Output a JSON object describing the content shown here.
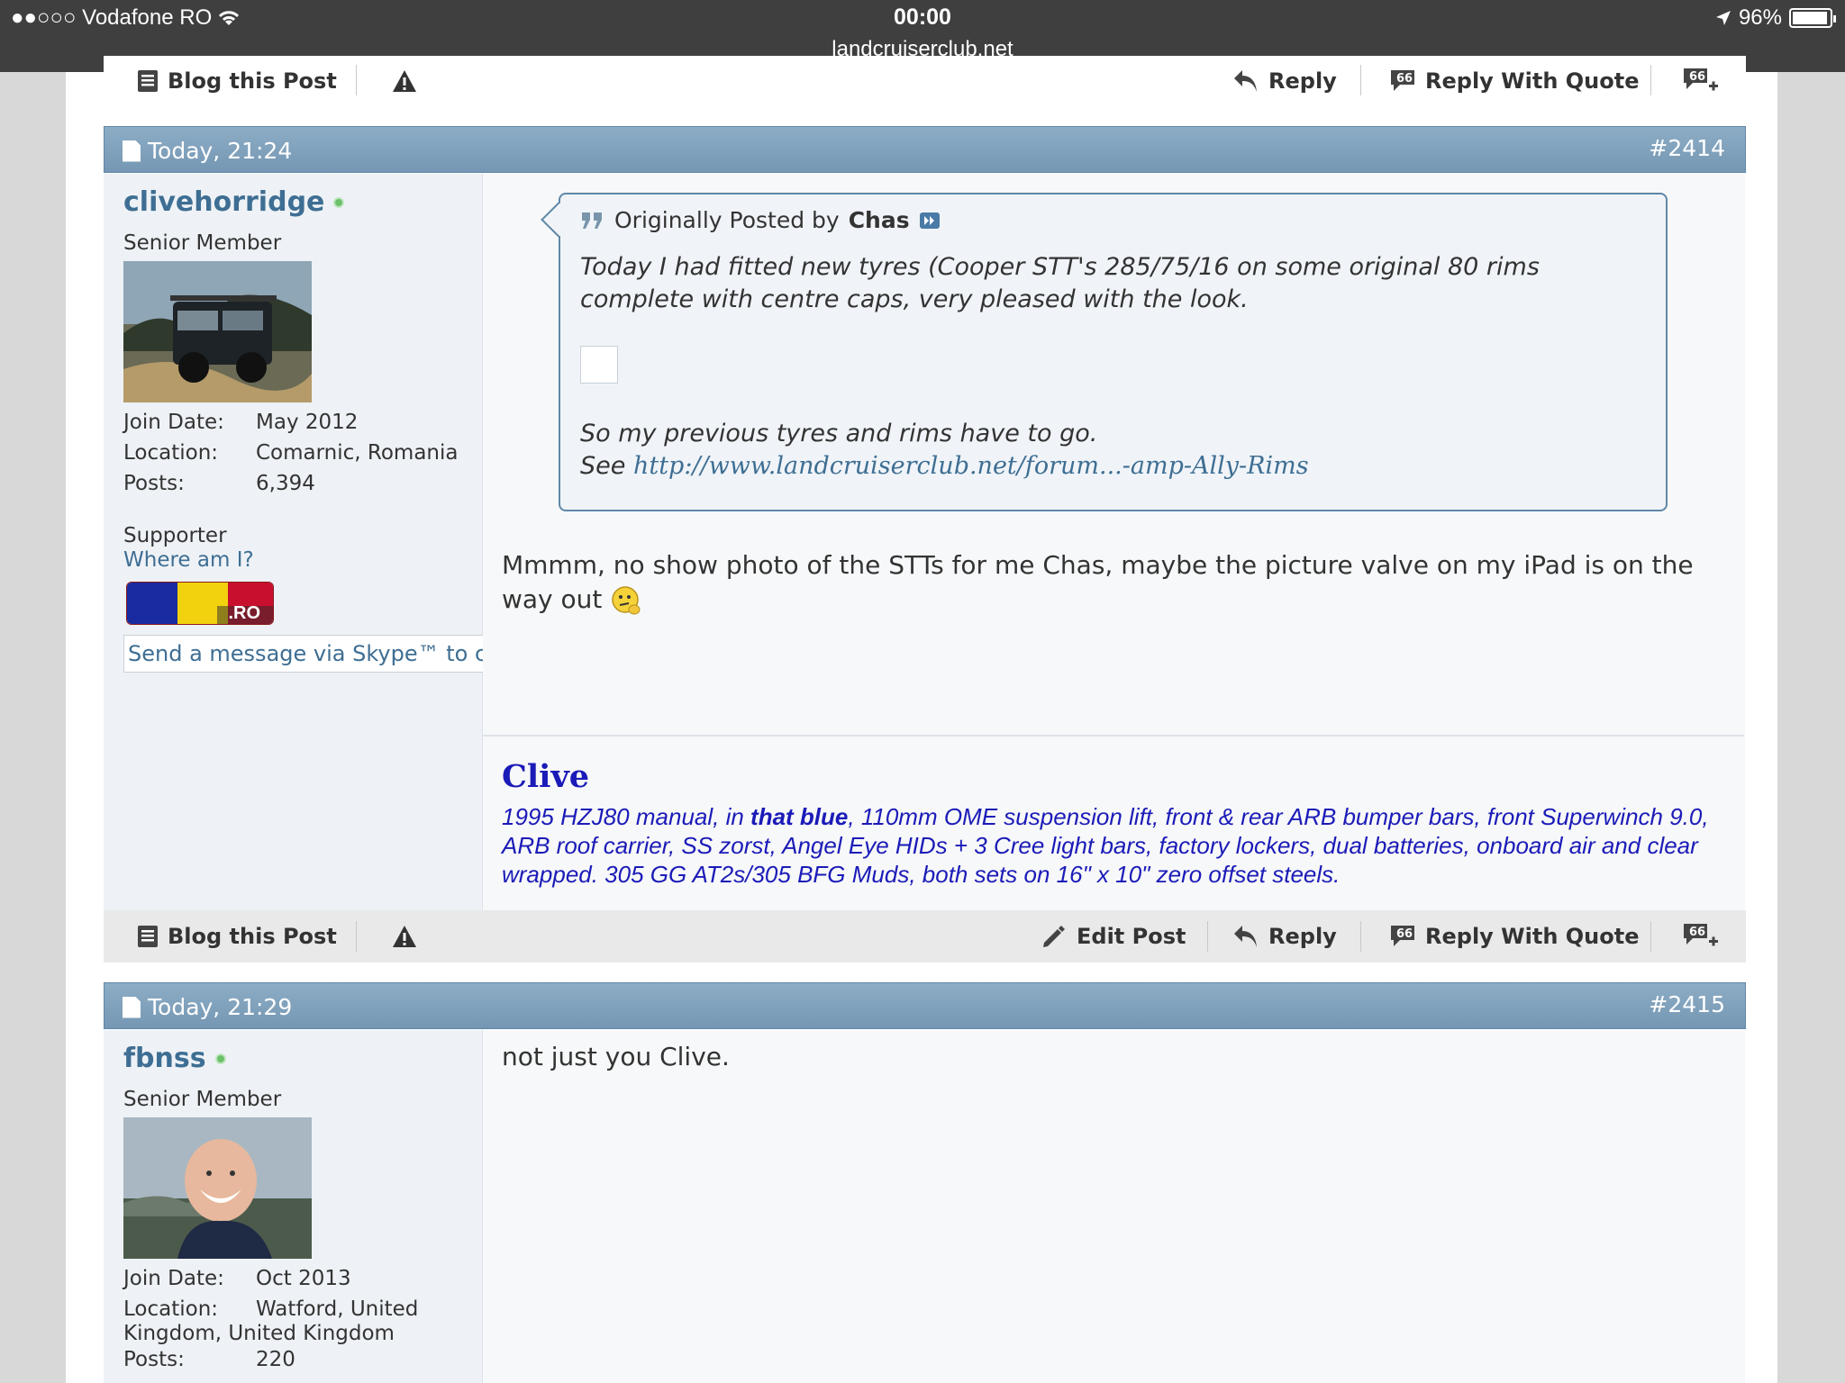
{
  "statusbar": {
    "carrier": "●●○○○ Vodafone RO",
    "time": "00:00",
    "url": "landcruiserclub.net",
    "battery": "96%"
  },
  "toolbar_top": {
    "blog": "Blog this Post",
    "reply": "Reply",
    "reply_quote": "Reply With Quote"
  },
  "post1": {
    "date": "Today, 21:24",
    "number": "#2414",
    "username": "clivehorridge",
    "user_title": "Senior Member",
    "join_label": "Join Date:",
    "join_value": "May 2012",
    "location_label": "Location:",
    "location_value": "Comarnic, Romania",
    "posts_label": "Posts:",
    "posts_value": "6,394",
    "supporter": "Supporter",
    "where_am_i": "Where am I?",
    "flag_code": ".RO",
    "skype": "Send a message via Skype™ to clivehorridge",
    "quote": {
      "prefix": "Originally Posted by",
      "author": "Chas",
      "line1": "Today I had fitted new tyres (Cooper STT's 285/75/16 on some original 80 rims",
      "line2": "complete with centre caps, very pleased with the look.",
      "line3": "So my previous tyres and rims have to go.",
      "see": "See",
      "link": "http://www.landcruiserclub.net/forum...-amp-Ally-Rims"
    },
    "message": "Mmmm, no show photo of the STTs for me Chas, maybe the picture valve on my iPad is on the way out",
    "signature": {
      "name": "Clive",
      "pre": "1995 HZJ80 manual, in ",
      "bold": "that blue",
      "post": ", 110mm OME suspension lift, front & rear ARB bumper bars, front Superwinch 9.0, ARB roof carrier, SS zorst, Angel Eye HIDs + 3 Cree light bars, factory lockers, dual batteries, onboard air and clear wrapped. 305 GG AT2s/305 BFG Muds, both sets on 16\" x 10\" zero offset steels."
    }
  },
  "toolbar_mid": {
    "blog": "Blog this Post",
    "edit": "Edit Post",
    "reply": "Reply",
    "reply_quote": "Reply With Quote"
  },
  "post2": {
    "date": "Today, 21:29",
    "number": "#2415",
    "username": "fbnss",
    "user_title": "Senior Member",
    "join_label": "Join Date:",
    "join_value": "Oct 2013",
    "location_label": "Location:",
    "location_value": "Watford, United",
    "location_cont": "Kingdom, United Kingdom",
    "posts_label": "Posts:",
    "posts_value": "220",
    "message": "not just you Clive."
  },
  "colors": {
    "link": "#3e6e93",
    "header": "#7f9fbb",
    "signature": "#1b1bb8"
  }
}
